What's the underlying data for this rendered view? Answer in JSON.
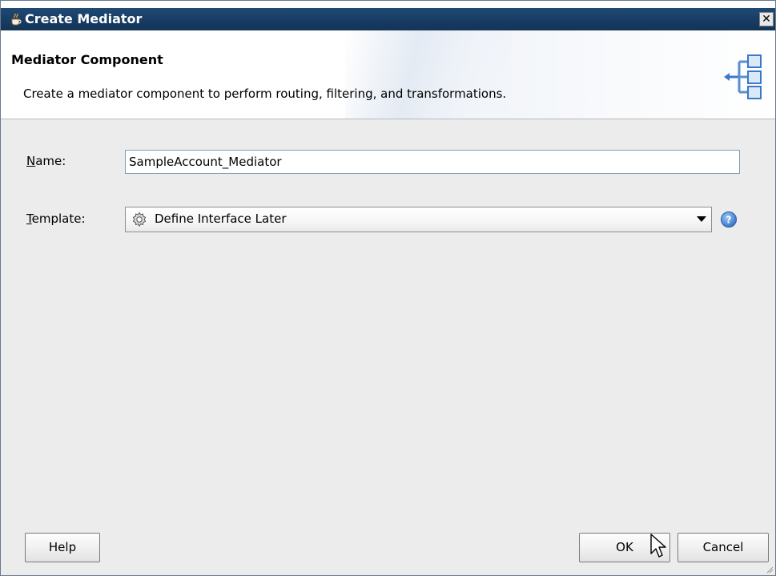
{
  "window": {
    "title": "Create Mediator",
    "close_glyph": "✕"
  },
  "header": {
    "title": "Mediator Component",
    "description": "Create a mediator component to perform routing, filtering, and transformations.",
    "icon": "mediator-component-icon"
  },
  "form": {
    "name_label_mnemonic": "N",
    "name_label_rest": "ame:",
    "name_value": "SampleAccount_Mediator",
    "template_label_mnemonic": "T",
    "template_label_rest": "emplate:",
    "template_value": "Define Interface Later",
    "template_icon": "gear-icon",
    "help_icon": "help-icon"
  },
  "buttons": {
    "help_label": "Help",
    "ok_label": "OK",
    "cancel_label": "Cancel"
  },
  "colors": {
    "titlebar": "#173c63",
    "dialog_bg": "#ececec",
    "accent_blue": "#3a78c9"
  }
}
